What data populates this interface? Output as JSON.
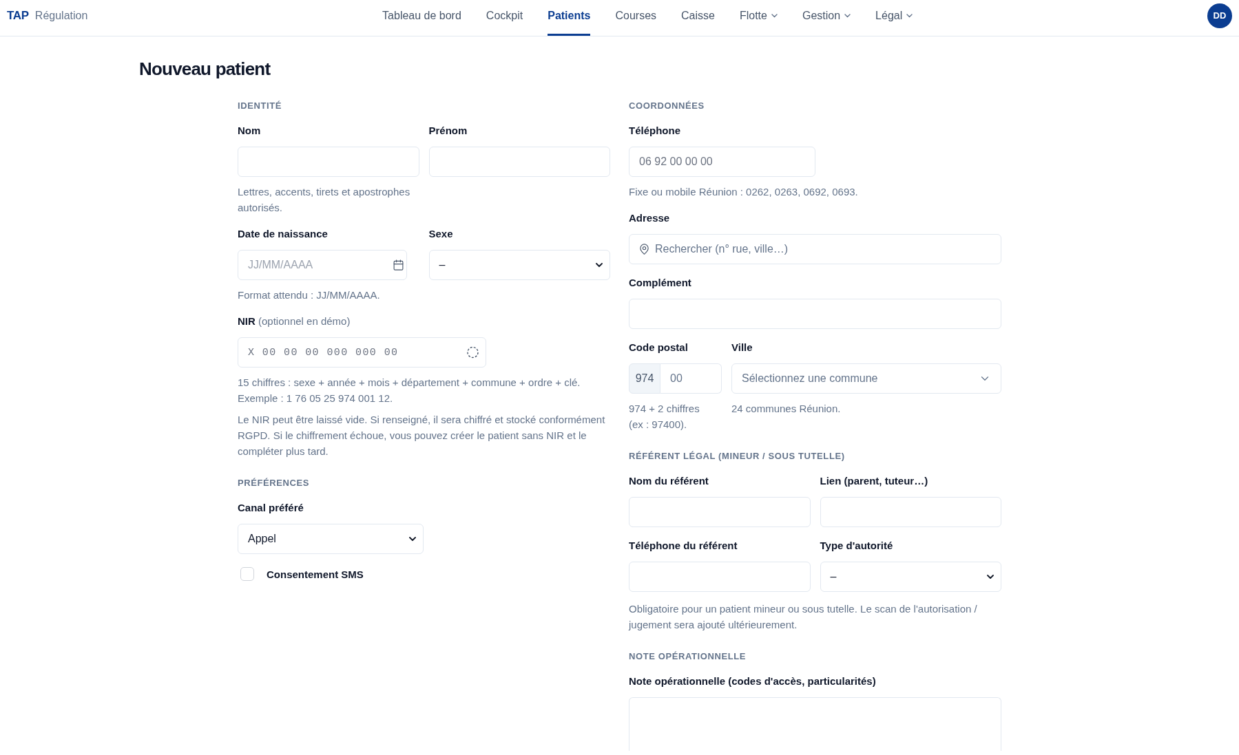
{
  "header": {
    "brand": "TAP",
    "subtitle": "Régulation",
    "nav": [
      {
        "label": "Tableau de bord",
        "selected": false,
        "dropdown": false
      },
      {
        "label": "Cockpit",
        "selected": false,
        "dropdown": false
      },
      {
        "label": "Patients",
        "selected": true,
        "dropdown": false
      },
      {
        "label": "Courses",
        "selected": false,
        "dropdown": false
      },
      {
        "label": "Caisse",
        "selected": false,
        "dropdown": false
      },
      {
        "label": "Flotte",
        "selected": false,
        "dropdown": true
      },
      {
        "label": "Gestion",
        "selected": false,
        "dropdown": true
      },
      {
        "label": "Légal",
        "selected": false,
        "dropdown": true
      }
    ],
    "avatar": "DD"
  },
  "title": "Nouveau patient",
  "columns": [
    {
      "sections": [
        {
          "heading": "IDENTITÉ",
          "rows": [
            {
              "fields": [
                {
                  "kind": "text",
                  "label": "Nom",
                  "help": [
                    "Lettres, accents, tirets et apostrophes autorisés."
                  ]
                },
                {
                  "kind": "text",
                  "label": "Prénom"
                }
              ]
            },
            {
              "fields": [
                {
                  "kind": "date",
                  "label": "Date de naissance",
                  "placeholder": "JJ/MM/AAAA",
                  "help": [
                    "Format attendu : JJ/MM/AAAA."
                  ]
                },
                {
                  "kind": "select",
                  "label": "Sexe",
                  "value": "–"
                }
              ]
            },
            {
              "fields": [
                {
                  "kind": "nir",
                  "label": "NIR",
                  "label_note": "(optionnel en démo)",
                  "placeholder": "X 00 00 00 000 000 00",
                  "help": [
                    "15 chiffres : sexe + année + mois + département + commune + ordre + clé. Exemple : 1 76 05 25 974 001 12.",
                    "Le NIR peut être laissé vide. Si renseigné, il sera chiffré et stocké conformément RGPD. Si le chiffrement échoue, vous pouvez créer le patient sans NIR et le compléter plus tard."
                  ]
                }
              ]
            }
          ]
        },
        {
          "heading": "PRÉFÉRENCES",
          "rows": [
            {
              "fields": [
                {
                  "kind": "select",
                  "label": "Canal préféré",
                  "value": "Appel"
                }
              ]
            },
            {
              "fields": [
                {
                  "kind": "checkbox",
                  "label": "Consentement SMS",
                  "checked": false
                }
              ]
            }
          ]
        }
      ]
    },
    {
      "sections": [
        {
          "heading": "COORDONNÉES",
          "rows": [
            {
              "fields": [
                {
                  "kind": "phone",
                  "label": "Téléphone",
                  "placeholder": "06 92 00 00 00",
                  "help": [
                    "Fixe ou mobile Réunion : 0262, 0263, 0692, 0693."
                  ]
                }
              ]
            },
            {
              "fields": [
                {
                  "kind": "address",
                  "label": "Adresse",
                  "placeholder": "Rechercher (n° rue, ville…)"
                }
              ]
            },
            {
              "fields": [
                {
                  "kind": "text",
                  "label": "Complément"
                }
              ]
            },
            {
              "fields": [
                {
                  "kind": "postal",
                  "label": "Code postal",
                  "prefix": "974",
                  "placeholder": "00",
                  "help": [
                    "974 + 2 chiffres (ex : 97400)."
                  ]
                },
                {
                  "kind": "combobox",
                  "label": "Ville",
                  "placeholder": "Sélectionnez une commune",
                  "help": [
                    "24 communes Réunion."
                  ]
                }
              ]
            }
          ]
        },
        {
          "heading": "RÉFÉRENT LÉGAL (MINEUR / SOUS TUTELLE)",
          "rows": [
            {
              "fields": [
                {
                  "kind": "text",
                  "label": "Nom du référent"
                },
                {
                  "kind": "text",
                  "label": "Lien (parent, tuteur…)"
                }
              ]
            },
            {
              "fields": [
                {
                  "kind": "text",
                  "label": "Téléphone du référent"
                },
                {
                  "kind": "select",
                  "label": "Type d'autorité",
                  "value": "–"
                }
              ],
              "help": [
                "Obligatoire pour un patient mineur ou sous tutelle. Le scan de l'autorisation / jugement sera ajouté ultérieurement."
              ]
            }
          ]
        },
        {
          "heading": "NOTE OPÉRATIONNELLE",
          "rows": [
            {
              "fields": [
                {
                  "kind": "textarea",
                  "label": "Note opérationnelle (codes d'accès, particularités)"
                }
              ]
            }
          ]
        }
      ]
    }
  ]
}
